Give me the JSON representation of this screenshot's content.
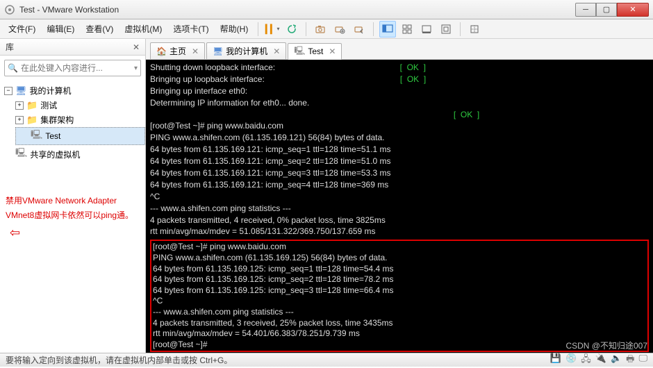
{
  "window": {
    "title": "Test - VMware Workstation"
  },
  "menu": {
    "file": "文件(F)",
    "edit": "编辑(E)",
    "view": "查看(V)",
    "vm": "虚拟机(M)",
    "tabs": "选项卡(T)",
    "help": "帮助(H)"
  },
  "sidebar": {
    "title": "库",
    "search_placeholder": "在此处键入内容进行...",
    "tree": {
      "root": "我的计算机",
      "items": [
        "测试",
        "集群架构",
        "Test"
      ],
      "shared": "共享的虚拟机"
    }
  },
  "annotation": {
    "text": "禁用VMware Network Adapter VMnet8虚拟网卡依然可以ping通。"
  },
  "tabs": {
    "home": "主页",
    "my_computer": "我的计算机",
    "test": "Test"
  },
  "terminal": {
    "line1": "Shutting down loopback interface:",
    "line2": "Bringing up loopback interface:",
    "line3": "Bringing up interface eth0:",
    "line4": "Determining IP information for eth0... done.",
    "ok": "[  OK  ]",
    "prompt1": "[root@Test ~]# ping www.baidu.com",
    "ping1_header": "PING www.a.shifen.com (61.135.169.121) 56(84) bytes of data.",
    "ping1_lines": [
      "64 bytes from 61.135.169.121: icmp_seq=1 ttl=128 time=51.1 ms",
      "64 bytes from 61.135.169.121: icmp_seq=2 ttl=128 time=51.0 ms",
      "64 bytes from 61.135.169.121: icmp_seq=3 ttl=128 time=53.3 ms",
      "64 bytes from 61.135.169.121: icmp_seq=4 ttl=128 time=369 ms"
    ],
    "ctrlc": "^C",
    "stats1_header": "--- www.a.shifen.com ping statistics ---",
    "stats1_line1": "4 packets transmitted, 4 received, 0% packet loss, time 3825ms",
    "stats1_line2": "rtt min/avg/max/mdev = 51.085/131.322/369.750/137.659 ms",
    "prompt2": "[root@Test ~]# ping www.baidu.com",
    "ping2_header": "PING www.a.shifen.com (61.135.169.125) 56(84) bytes of data.",
    "ping2_lines": [
      "64 bytes from 61.135.169.125: icmp_seq=1 ttl=128 time=54.4 ms",
      "64 bytes from 61.135.169.125: icmp_seq=2 ttl=128 time=78.2 ms",
      "64 bytes from 61.135.169.125: icmp_seq=3 ttl=128 time=66.4 ms"
    ],
    "stats2_header": "--- www.a.shifen.com ping statistics ---",
    "stats2_line1": "4 packets transmitted, 3 received, 25% packet loss, time 3435ms",
    "stats2_line2": "rtt min/avg/max/mdev = 54.401/66.383/78.251/9.739 ms",
    "prompt3": "[root@Test ~]#"
  },
  "status": {
    "text": "要将输入定向到该虚拟机，请在虚拟机内部单击或按 Ctrl+G。",
    "watermark": "CSDN @不知归途007"
  }
}
